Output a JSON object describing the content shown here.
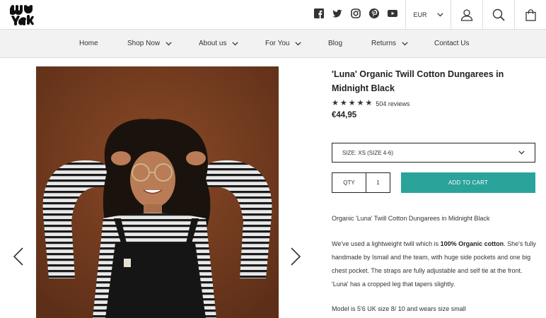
{
  "header": {
    "logo_icon": "brand-logo",
    "social_icons": [
      "facebook-icon",
      "twitter-icon",
      "instagram-icon",
      "pinterest-icon",
      "youtube-icon"
    ],
    "currency": "EUR",
    "account_icon": "user-icon",
    "search_icon": "search-icon",
    "cart_icon": "shopping-bag-icon"
  },
  "nav": {
    "items": [
      {
        "label": "Home",
        "dropdown": false
      },
      {
        "label": "Shop Now",
        "dropdown": true
      },
      {
        "label": "About us",
        "dropdown": true
      },
      {
        "label": "For You",
        "dropdown": true
      },
      {
        "label": "Blog",
        "dropdown": false
      },
      {
        "label": "Returns",
        "dropdown": true
      },
      {
        "label": "Contact Us",
        "dropdown": false
      }
    ]
  },
  "gallery": {
    "prev_icon": "chevron-left-icon",
    "next_icon": "chevron-right-icon"
  },
  "product": {
    "title": "'Luna' Organic Twill Cotton Dungarees in Midnight Black",
    "rating_stars": 5,
    "reviews": "504 reviews",
    "price": "€44,95",
    "size_label": "SIZE: XS (SIZE 4-6)",
    "qty_label": "QTY",
    "qty_value": "1",
    "add_to_cart": "ADD TO CART",
    "desc_line1": "Organic 'Luna' Twill Cotton Dungarees in Midnight Black",
    "desc_p2_a": "We've used a lightweight twill which is ",
    "desc_p2_bold": "100% Organic cotton",
    "desc_p2_b": ". She's fully handmade by Ismail and the team, with huge side pockets and one big chest pocket. The straps are fully adjustable and self tie at the front. 'Luna' has a cropped leg that tapers slightly.",
    "desc_line3": "Model is 5'6 UK size 8/ 10 and wears size small"
  },
  "colors": {
    "accent": "#2aa39a",
    "photo_bg": "#7a3f20",
    "nav_bg": "#f2f2f2"
  }
}
